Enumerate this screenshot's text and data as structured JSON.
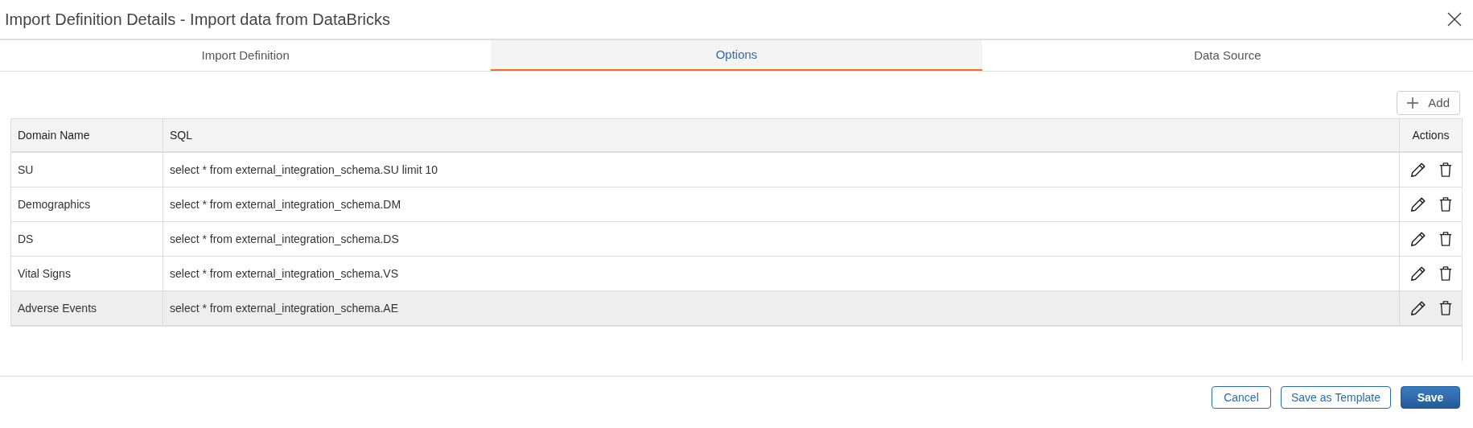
{
  "dialog": {
    "title": "Import Definition Details - Import data from DataBricks"
  },
  "tabs": [
    {
      "label": "Import Definition",
      "selected": false
    },
    {
      "label": "Options",
      "selected": true
    },
    {
      "label": "Data Source",
      "selected": false
    }
  ],
  "add_button": {
    "label": "Add"
  },
  "table": {
    "columns": [
      "Domain Name",
      "SQL",
      "Actions"
    ],
    "rows": [
      {
        "domain": "SU",
        "sql": "select * from external_integration_schema.SU limit 10",
        "highlighted": false
      },
      {
        "domain": "Demographics",
        "sql": "select * from external_integration_schema.DM",
        "highlighted": false
      },
      {
        "domain": "DS",
        "sql": "select * from external_integration_schema.DS",
        "highlighted": false
      },
      {
        "domain": "Vital Signs",
        "sql": "select * from external_integration_schema.VS",
        "highlighted": false
      },
      {
        "domain": "Adverse Events",
        "sql": "select * from external_integration_schema.AE",
        "highlighted": true
      }
    ]
  },
  "footer_buttons": [
    {
      "label": "Cancel",
      "kind": "outline"
    },
    {
      "label": "Save as Template",
      "kind": "outline"
    },
    {
      "label": "Save",
      "kind": "primary"
    }
  ]
}
